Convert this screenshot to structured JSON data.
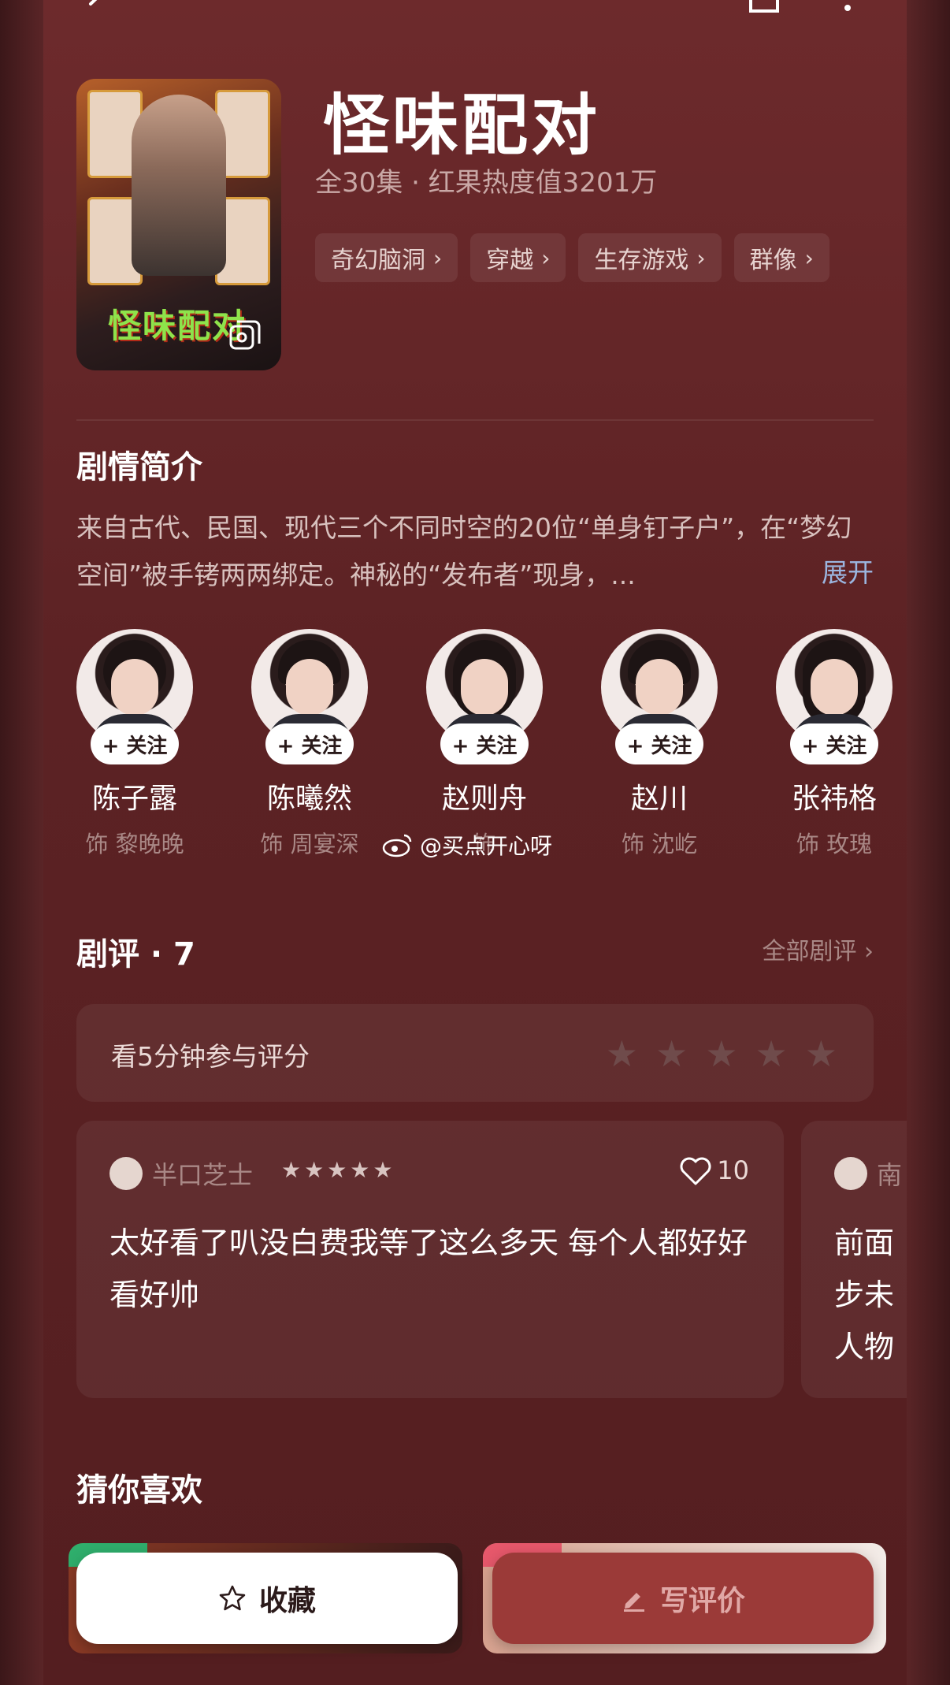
{
  "header": {
    "title": "怪味配对",
    "meta": "全30集 · 红果热度值3201万",
    "poster_title": "怪味配对",
    "tags": [
      {
        "label": "奇幻脑洞"
      },
      {
        "label": "穿越"
      },
      {
        "label": "生存游戏"
      },
      {
        "label": "群像"
      }
    ]
  },
  "synopsis": {
    "title": "剧情简介",
    "text": "来自古代、民国、现代三个不同时空的20位“单身钉子户”，在“梦幻空间”被手铐两两绑定。神秘的“发布者”现身，...",
    "expand_label": "展开"
  },
  "cast": [
    {
      "name": "陈子露",
      "role": "饰 黎晚晚",
      "follow": "+ 关注"
    },
    {
      "name": "陈曦然",
      "role": "饰 周宴深",
      "follow": "+ 关注"
    },
    {
      "name": "赵则舟",
      "role": "饰 ",
      "follow": "+ 关注"
    },
    {
      "name": "赵川",
      "role": "饰 沈屹",
      "follow": "+ 关注"
    },
    {
      "name": "张祎格",
      "role": "饰 玫瑰",
      "follow": "+ 关注"
    }
  ],
  "watermark": "@买点开心呀",
  "reviews": {
    "title": "剧评 · 7",
    "all_label": "全部剧评 ›",
    "rate_prompt": "看5分钟参与评分",
    "items": [
      {
        "user": "半口芝士",
        "stars": "★★★★★",
        "likes": "10",
        "text": "太好看了叭没白费我等了这么多天 每个人都好好看好帅"
      },
      {
        "user": "南",
        "text": "前面步未人物"
      }
    ]
  },
  "recommend": {
    "title": "猜你喜欢"
  },
  "bottom": {
    "favorite_label": "收藏",
    "write_review_label": "写评价"
  },
  "colors": {
    "background": "#5c2224",
    "accent_link": "#9bb6e0",
    "review_button": "#9b3a38"
  }
}
